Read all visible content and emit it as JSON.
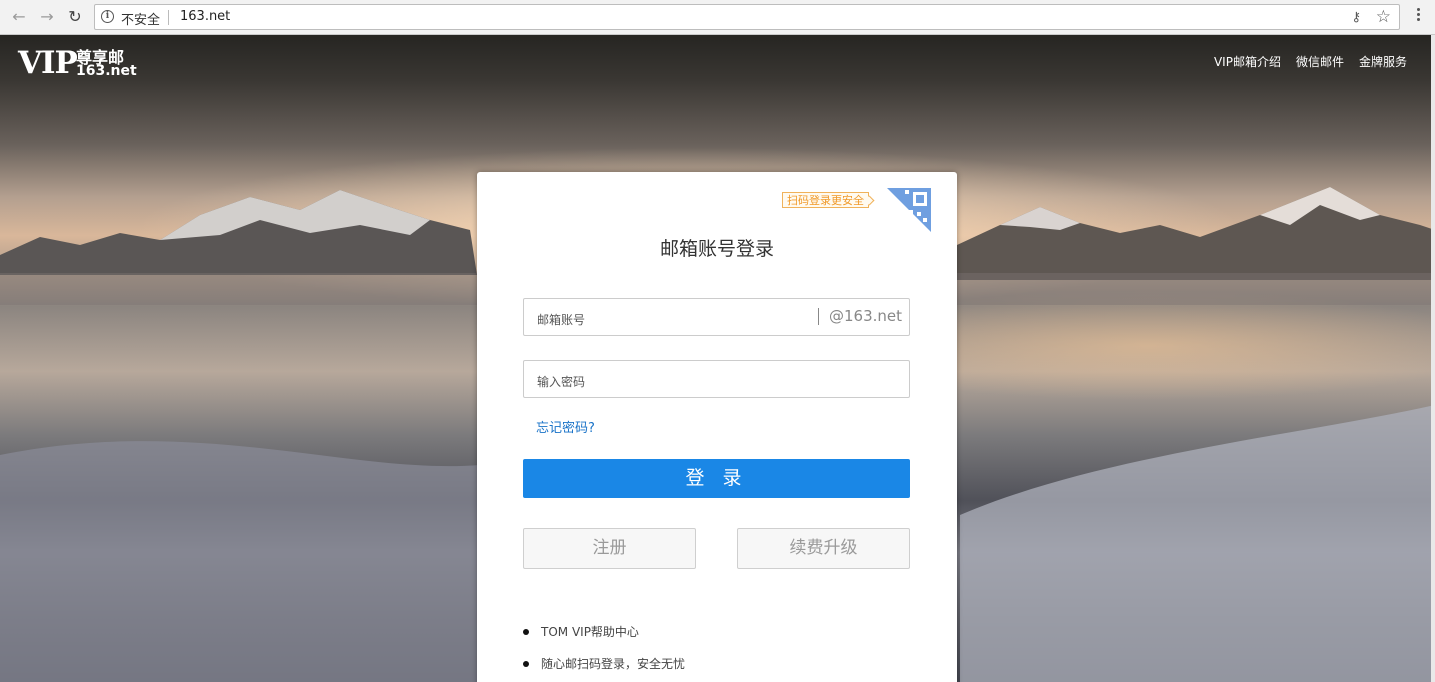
{
  "browser": {
    "security_label": "不安全",
    "url": "163.net"
  },
  "header": {
    "logo": {
      "vip": "VIP",
      "name": "尊享邮",
      "domain": "163.net"
    },
    "nav": [
      "VIP邮箱介绍",
      "微信邮件",
      "金牌服务"
    ]
  },
  "login": {
    "qr_tip": "扫码登录更安全",
    "title": "邮箱账号登录",
    "account_placeholder": "邮箱账号",
    "account_suffix": "@163.net",
    "password_placeholder": "输入密码",
    "forgot": "忘记密码?",
    "submit": "登 录",
    "register": "注册",
    "renew": "续费升级",
    "links": [
      "TOM VIP帮助中心",
      "随心邮扫码登录，安全无忧"
    ]
  },
  "colors": {
    "primary": "#1a87e6",
    "link": "#1a73c8",
    "tip": "#f09a2a"
  }
}
